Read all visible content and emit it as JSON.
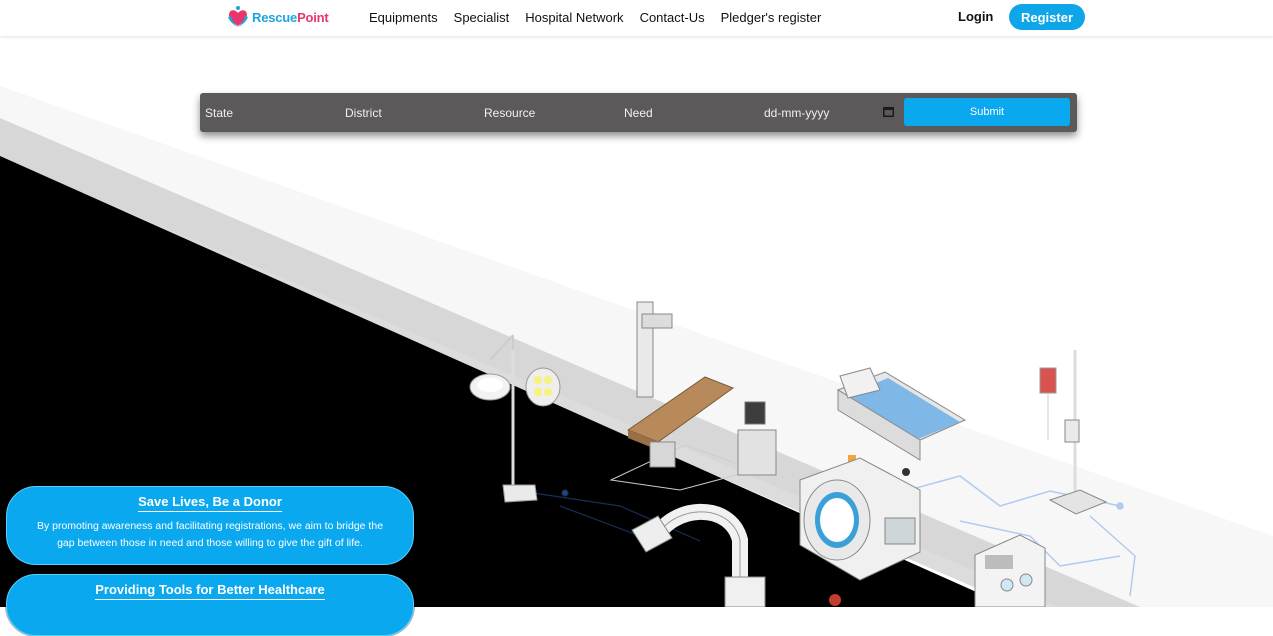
{
  "brand": {
    "name_part1": "Rescue",
    "name_part2": "Point",
    "logo_icon": "heart-hands-icon",
    "colors": {
      "blue": "#1fa3dd",
      "pink": "#e8356b"
    }
  },
  "nav": {
    "links": [
      "Equipments",
      "Specialist",
      "Hospital Network",
      "Contact-Us",
      "Pledger's register"
    ],
    "login_label": "Login",
    "register_label": "Register"
  },
  "search": {
    "state_label": "State",
    "district_label": "District",
    "resource_label": "Resource",
    "need_label": "Need",
    "date_placeholder": "dd-mm-yyyy",
    "calendar_icon": "calendar-icon",
    "submit_label": "Submit"
  },
  "cards": [
    {
      "title": "Save Lives, Be a Donor",
      "text": "By promoting awareness and facilitating registrations, we aim to bridge the gap between those in need and those willing to give the gift of life."
    },
    {
      "title": "Providing Tools for Better Healthcare",
      "text": ""
    }
  ],
  "colors": {
    "accent": "#0aa8ef",
    "search_bar_bg": "#5b5959",
    "hero_dark": "#000000"
  }
}
